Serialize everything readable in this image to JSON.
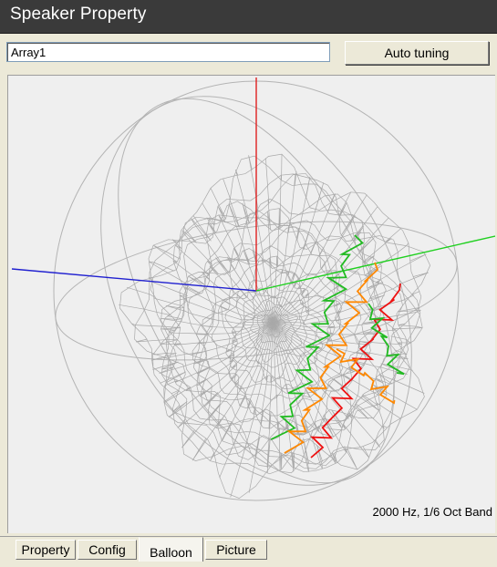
{
  "window": {
    "title": "Speaker Property"
  },
  "toolbar": {
    "name_value": "Array1",
    "auto_tuning_label": "Auto tuning"
  },
  "viewport": {
    "status": "2000 Hz, 1/6 Oct Band",
    "axis_colors": {
      "z": "#e02020",
      "x": "#2020d0",
      "y": "#20d020"
    },
    "mesh_color": "#a9a9a9",
    "contour_colors": [
      "#22bb22",
      "#ff8800",
      "#ee1111"
    ]
  },
  "tabs": [
    {
      "label": "Property",
      "active": false
    },
    {
      "label": "Config",
      "active": false
    },
    {
      "label": "Balloon",
      "active": true
    },
    {
      "label": "Picture",
      "active": false
    }
  ]
}
